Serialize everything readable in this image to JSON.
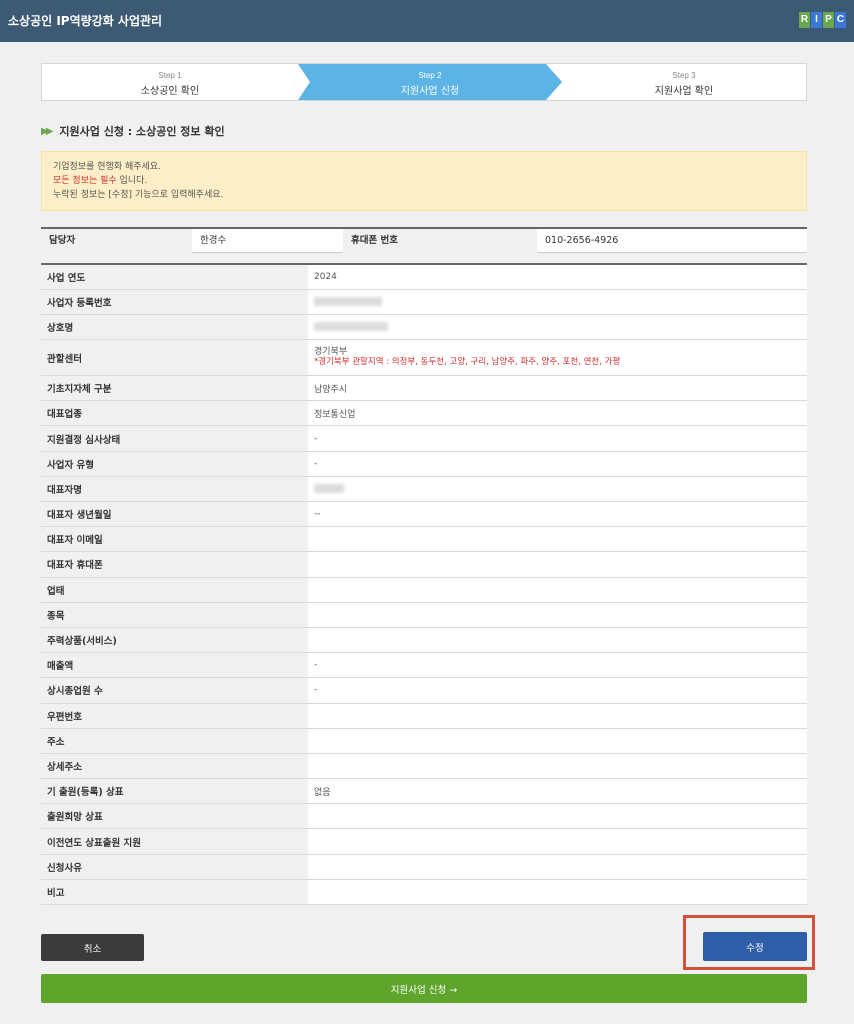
{
  "header": {
    "title": "소상공인 IP역량강화 사업관리",
    "logo_letters": [
      "R",
      "I",
      "P",
      "C"
    ],
    "logo_colors": [
      "#6aa84f",
      "#3c78d8",
      "#6aa84f",
      "#3c78d8"
    ]
  },
  "steps": [
    {
      "num": "Step 1",
      "label": "소상공인 확인",
      "active": false
    },
    {
      "num": "Step 2",
      "label": "지원사업 신청",
      "active": true
    },
    {
      "num": "Step 3",
      "label": "지원사업 확인",
      "active": false
    }
  ],
  "section": {
    "title": "지원사업 신청 : 소상공인 정보 확인"
  },
  "notice": {
    "line1": "기업정보를 현행화 해주세요.",
    "line2_red": "모든 정보는 필수",
    "line2_rest": " 입니다.",
    "line3": "누락된 정보는 [수정] 기능으로 입력해주세요."
  },
  "contact": {
    "manager_label": "담당자",
    "manager_value": "한경수",
    "phone_label": "휴대폰 번호",
    "phone_value": "010-2656-4926"
  },
  "rows": [
    {
      "label": "사업 연도",
      "value": "2024"
    },
    {
      "label": "사업자 등록번호",
      "value": "",
      "redacted": true
    },
    {
      "label": "상호명",
      "value": "",
      "redacted": true
    },
    {
      "label": "관할센터",
      "value": "경기북부",
      "sub": "*경기북부 관할지역 : 의정부, 동두천, 고양, 구리, 남양주, 파주, 양주, 포천, 연천, 가평"
    },
    {
      "label": "기초지자체 구분",
      "value": "남양주시"
    },
    {
      "label": "대표업종",
      "value": "정보통신업"
    },
    {
      "label": "지원결정 심사상태",
      "value": "-"
    },
    {
      "label": "사업자 유형",
      "value": "-"
    },
    {
      "label": "대표자명",
      "value": "",
      "redacted": true
    },
    {
      "label": "대표자 생년월일",
      "value": "--"
    },
    {
      "label": "대표자 이메일",
      "value": ""
    },
    {
      "label": "대표자 휴대폰",
      "value": ""
    },
    {
      "label": "업태",
      "value": ""
    },
    {
      "label": "종목",
      "value": ""
    },
    {
      "label": "주력상품(서비스)",
      "value": ""
    },
    {
      "label": "매출액",
      "value": "-"
    },
    {
      "label": "상시종업원 수",
      "value": "-"
    },
    {
      "label": "우편번호",
      "value": ""
    },
    {
      "label": "주소",
      "value": ""
    },
    {
      "label": "상세주소",
      "value": ""
    },
    {
      "label": "기 출원(등록) 상표",
      "value": "없음"
    },
    {
      "label": "출원희망 상표",
      "value": ""
    },
    {
      "label": "이전연도 상표출원 지원",
      "value": ""
    },
    {
      "label": "신청사유",
      "value": ""
    },
    {
      "label": "비고",
      "value": ""
    }
  ],
  "buttons": {
    "cancel": "취소",
    "edit": "수정",
    "apply": "지원사업 신청 →"
  },
  "colors": {
    "header_bg": "#3d5a75",
    "active_step": "#5cb3e6",
    "edit_button": "#2f5ea8",
    "apply_button": "#5fa52c",
    "highlight": "#d0513a"
  }
}
